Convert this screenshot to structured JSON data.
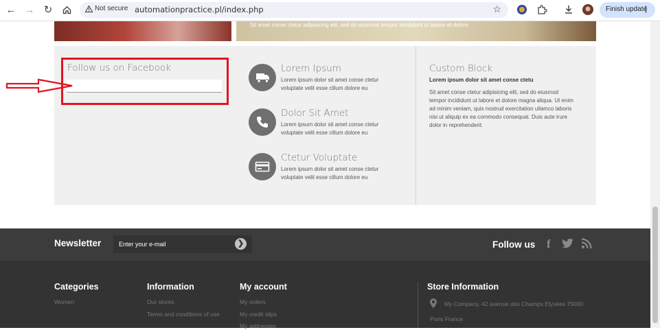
{
  "browser": {
    "security_label": "Not secure",
    "url": "automationpractice.pl/index.php",
    "finish_update": "Finish update"
  },
  "banner": {
    "text": "Sit amet conse ctetur adipisicing elit, sed do eiusmod tempor incididunt ut labore et dolore"
  },
  "facebook": {
    "title": "Follow us on Facebook"
  },
  "info": [
    {
      "title": "Lorem Ipsum",
      "desc": "Lorem ipsum dolor sit amet conse ctetur voluptate velit esse cillum dolore eu",
      "icon": "truck-icon"
    },
    {
      "title": "Dolor Sit Amet",
      "desc": "Lorem ipsum dolor sit amet conse ctetur voluptate velit esse cillum dolore eu",
      "icon": "phone-icon"
    },
    {
      "title": "Ctetur Voluptate",
      "desc": "Lorem ipsum dolor sit amet conse ctetur voluptate velit esse cillum dolore eu",
      "icon": "credit-card-icon"
    }
  ],
  "custom_block": {
    "title": "Custom Block",
    "subtitle": "Lorem ipsum dolor sit amet conse ctetu",
    "text": "Sit amet conse ctetur adipisicing elit, sed do eiusmod tempor incididunt ut labore et dolore magna aliqua. Ut enim ad minim veniam, quis nostrud exercitation ullamco laboris nisi ut aliquip ex ea commodo consequat. Duis aute irure dolor in reprehenderit."
  },
  "newsletter": {
    "label": "Newsletter",
    "placeholder": "Enter your e-mail",
    "follow_label": "Follow us"
  },
  "footer": {
    "categories": {
      "title": "Categories",
      "items": [
        "Women"
      ]
    },
    "information": {
      "title": "Information",
      "items": [
        "Our stores",
        "Terms and conditions of use"
      ]
    },
    "account": {
      "title": "My account",
      "items": [
        "My orders",
        "My credit slips",
        "My addresses"
      ]
    },
    "store": {
      "title": "Store Information",
      "address": "My Company, 42 avenue des Champs Elysées 75000",
      "city": "Paris France"
    }
  },
  "colors": {
    "annotation_red": "#e0141f",
    "footer_dark": "#333333",
    "newsletter_bar": "#3c3c3c"
  }
}
